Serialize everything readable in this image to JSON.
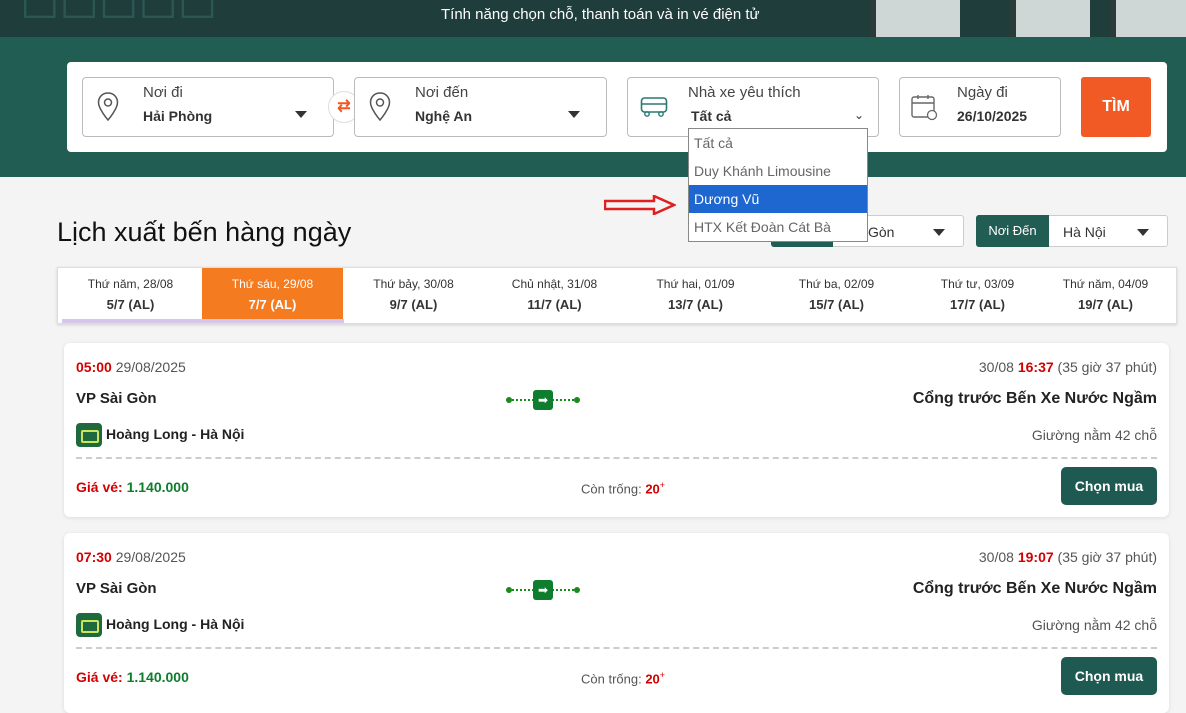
{
  "banner": {
    "tagline": "Tính năng chọn chỗ, thanh toán và in vé điện tử"
  },
  "search": {
    "from": {
      "label": "Nơi đi",
      "value": "Hải Phòng"
    },
    "to": {
      "label": "Nơi đến",
      "value": "Nghệ An"
    },
    "operator": {
      "label": "Nhà xe yêu thích",
      "value": "Tất cả"
    },
    "date": {
      "label": "Ngày đi",
      "value": "26/10/2025"
    },
    "submit_label": "TÌM",
    "swap_icon": "swap-icon"
  },
  "operator_options": [
    "Tất cả",
    "Duy Khánh Limousine",
    "Dương Vũ",
    "HTX Kết Đoàn Cát Bà"
  ],
  "operator_selected_index": 2,
  "page": {
    "heading": "Lịch xuất bến hàng ngày"
  },
  "filters": {
    "origin_value": "Gòn",
    "dest_label": "Nơi Đến",
    "dest_value": "Hà Nội"
  },
  "dates": [
    {
      "day": "Thứ năm, 28/08",
      "lunar": "5/7 (AL)"
    },
    {
      "day": "Thứ sáu, 29/08",
      "lunar": "7/7 (AL)"
    },
    {
      "day": "Thứ bảy, 30/08",
      "lunar": "9/7 (AL)"
    },
    {
      "day": "Chủ nhật, 31/08",
      "lunar": "11/7 (AL)"
    },
    {
      "day": "Thứ hai, 01/09",
      "lunar": "13/7 (AL)"
    },
    {
      "day": "Thứ ba, 02/09",
      "lunar": "15/7 (AL)"
    },
    {
      "day": "Thứ tư, 03/09",
      "lunar": "17/7 (AL)"
    },
    {
      "day": "Thứ năm, 04/09",
      "lunar": "19/7 (AL)"
    }
  ],
  "active_date_index": 1,
  "trips": [
    {
      "depart_time": "05:00",
      "depart_date": "29/08/2025",
      "arrive_date": "30/08",
      "arrive_time": "16:37",
      "duration": "(35 giờ 37 phút)",
      "from": "VP Sài Gòn",
      "to": "Cổng trước Bến Xe Nước Ngầm",
      "operator": "Hoàng Long - Hà Nội",
      "seat_type": "Giường nằm 42 chỗ",
      "price_label": "Giá vé:",
      "price": "1.140.000",
      "seats_label": "Còn trống:",
      "seats": "20",
      "buy_label": "Chọn mua"
    },
    {
      "depart_time": "07:30",
      "depart_date": "29/08/2025",
      "arrive_date": "30/08",
      "arrive_time": "19:07",
      "duration": "(35 giờ 37 phút)",
      "from": "VP Sài Gòn",
      "to": "Cổng trước Bến Xe Nước Ngầm",
      "operator": "Hoàng Long - Hà Nội",
      "seat_type": "Giường nằm 42 chỗ",
      "price_label": "Giá vé:",
      "price": "1.140.000",
      "seats_label": "Còn trống:",
      "seats": "20",
      "buy_label": "Chọn mua"
    }
  ]
}
